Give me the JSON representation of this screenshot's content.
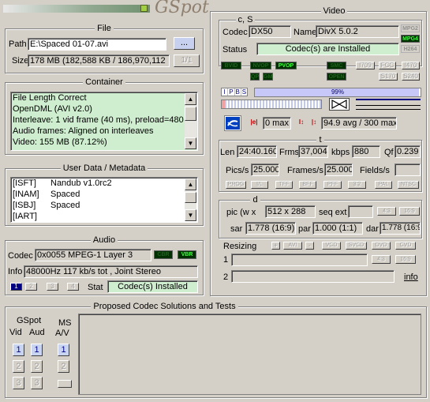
{
  "app": {
    "logo_text": "GSpot"
  },
  "file": {
    "group_title": "File",
    "path_label": "Path",
    "path_value": "E:\\Spaced 01-07.avi",
    "browse_label": "...",
    "size_label": "Size",
    "size_value": "178 MB (182,588 KB / 186,970,112",
    "part_label": "1/1"
  },
  "container": {
    "group_title": "Container",
    "items": [
      "File Length Correct",
      "OpenDML (AVI v2.0)",
      "Interleave: 1 vid frame (40 ms), preload=480",
      "Audio frames: Aligned on interleaves",
      "Video: 155 MB (87.12%)"
    ]
  },
  "userdata": {
    "group_title": "User Data / Metadata",
    "rows": [
      {
        "key": "[ISFT]",
        "value": "Nandub v1.0rc2"
      },
      {
        "key": "[INAM]",
        "value": "Spaced"
      },
      {
        "key": "[ISBJ]",
        "value": "Spaced"
      },
      {
        "key": "[IART]",
        "value": ""
      }
    ]
  },
  "audio": {
    "group_title": "Audio",
    "codec_label": "Codec",
    "codec_value": "0x0055 MPEG-1 Layer 3",
    "badge_cbr": "CBR",
    "badge_vbr": "VBR",
    "info_label": "Info",
    "info_value": "48000Hz  117 kb/s tot , Joint Stereo",
    "stream_tabs": [
      "1",
      "2",
      "3",
      "4"
    ],
    "stat_label": "Stat",
    "stat_value": "Codec(s) Installed"
  },
  "video": {
    "group_title": "Video",
    "cs_label": "c, S",
    "codec_label": "Codec",
    "codec_value": "DX50",
    "name_label": "Name",
    "name_value": "DivX 5.0.2",
    "badges_right": [
      "MPG2",
      "MPG4",
      "H264"
    ],
    "status_label": "Status",
    "status_value": "Codec(s) are Installed",
    "flags_row1": [
      "BVID",
      "NVOP",
      "PVOP",
      "SMC",
      "I709",
      "FCC",
      "I470"
    ],
    "flags_row2": [
      "QP",
      "GMC",
      "OPEN",
      "S170",
      "S240"
    ],
    "frame_types": [
      "I",
      "P",
      "B",
      "S"
    ],
    "bar_percent_label": "99%",
    "bar_percent": 99,
    "bitrate_min": "0 max",
    "bitrate_avg": "94.9 avg / 300 max",
    "t_label": "t",
    "len_label": "Len",
    "len_value": "24:40.160",
    "frms_label": "Frms",
    "frms_value": "37,004",
    "kbps_label": "kbps",
    "kbps_value": "880",
    "qf_label": "Qf",
    "qf_value": "0.239",
    "pics_label": "Pics/s",
    "pics_value": "25.000",
    "frames_label": "Frames/s",
    "frames_value": "25.000",
    "fields_label": "Fields/s",
    "fields_value": "",
    "scan_buttons": [
      "PROG",
      "I/L",
      "TFF",
      "BFF",
      "PFF",
      "3:2",
      "PAL",
      "NTSC"
    ],
    "d_label": "d",
    "pic_label": "pic (w x",
    "pic_value": "512 x 288",
    "seqext_label": "seq ext",
    "ar_buttons": [
      "4:3",
      "16:9"
    ],
    "sar_label": "sar",
    "sar_value": "1.778 (16:9)",
    "par_label": "par",
    "par_value": "1.000 (1:1)",
    "dar_label": "dar",
    "dar_value": "1.778 (16:9)",
    "resizing_label": "Resizing",
    "resize_buttons": [
      "+",
      "AVI",
      "-",
      "VCD",
      "SVCD",
      "DVD",
      "CVD"
    ],
    "row1_label": "1",
    "row2_label": "2",
    "ar2_buttons": [
      "4:3",
      "16:9"
    ],
    "info_link": "info"
  },
  "proposed": {
    "group_title": "Proposed Codec Solutions and Tests",
    "gspot_label": "GSpot",
    "vid_label": "Vid",
    "aud_label": "Aud",
    "ms_label": "MS",
    "av_label": "A/V",
    "numbers": [
      "1",
      "2",
      "3"
    ]
  }
}
